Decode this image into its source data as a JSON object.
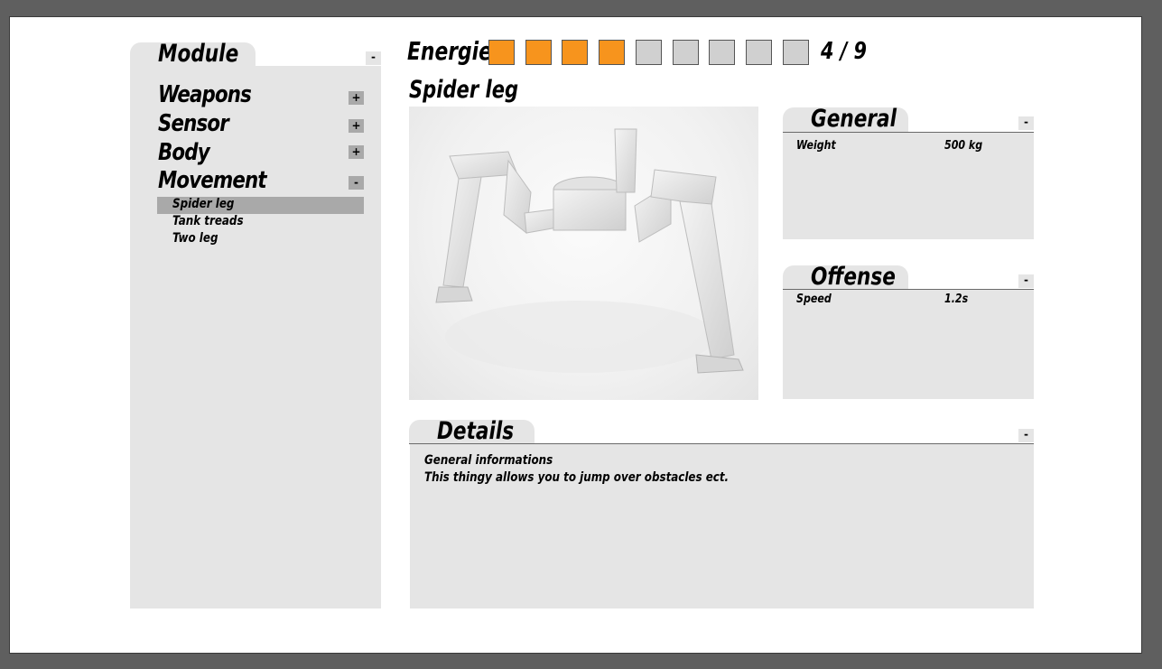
{
  "energy": {
    "label": "Energie",
    "filled": 4,
    "total": 9,
    "text": "4 / 9",
    "filled_color": "#f7941d",
    "empty_color": "#d0d0d0"
  },
  "module_panel": {
    "title": "Module",
    "collapse_label": "-",
    "categories": [
      {
        "label": "Weapons",
        "toggle": "+"
      },
      {
        "label": "Sensor",
        "toggle": "+"
      },
      {
        "label": "Body",
        "toggle": "+"
      },
      {
        "label": "Movement",
        "toggle": "-"
      }
    ],
    "movement_items": [
      "Spider leg",
      "Tank treads",
      "Two leg"
    ],
    "selected_item": "Spider leg"
  },
  "selected_module": {
    "title": "Spider leg",
    "image_icon": "spider-leg-render"
  },
  "general": {
    "title": "General",
    "collapse_label": "-",
    "rows": [
      {
        "label": "Weight",
        "value": "500 kg"
      }
    ]
  },
  "offense": {
    "title": "Offense",
    "collapse_label": "-",
    "rows": [
      {
        "label": "Speed",
        "value": "1.2s"
      }
    ]
  },
  "details": {
    "title": "Details",
    "collapse_label": "-",
    "line1": "General informations",
    "line2": "This thingy allows you to jump over obstacles ect."
  }
}
